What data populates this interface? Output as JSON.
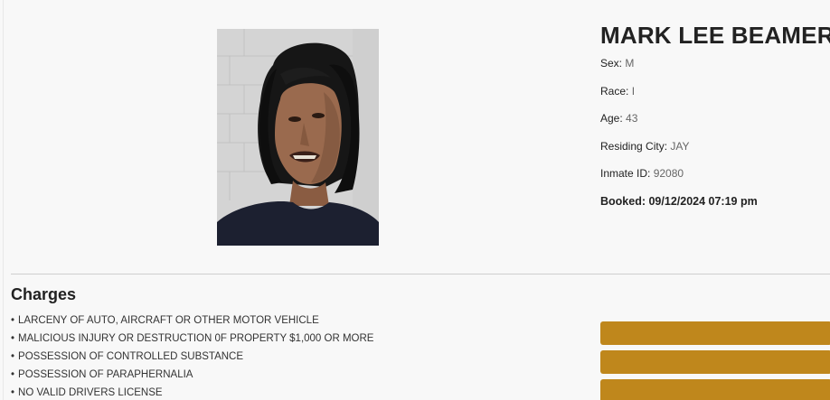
{
  "inmate": {
    "name": "MARK LEE BEAMER",
    "sex_label": "Sex:",
    "sex": "M",
    "race_label": "Race:",
    "race": "I",
    "age_label": "Age:",
    "age": "43",
    "city_label": "Residing City:",
    "city": "JAY",
    "id_label": "Inmate ID:",
    "id": "92080",
    "booked_label": "Booked:",
    "booked": "09/12/2024 07:19 pm"
  },
  "charges": {
    "title": "Charges",
    "items": [
      "LARCENY OF AUTO, AIRCRAFT OR OTHER MOTOR VEHICLE",
      "MALICIOUS INJURY OR DESTRUCTION 0F PROPERTY $1,000 OR MORE",
      "POSSESSION OF CONTROLLED SUBSTANCE",
      "POSSESSION OF PARAPHERNALIA",
      "NO VALID DRIVERS LICENSE"
    ]
  },
  "colors": {
    "accent": "#bf871c",
    "background": "#f8f8f8"
  }
}
